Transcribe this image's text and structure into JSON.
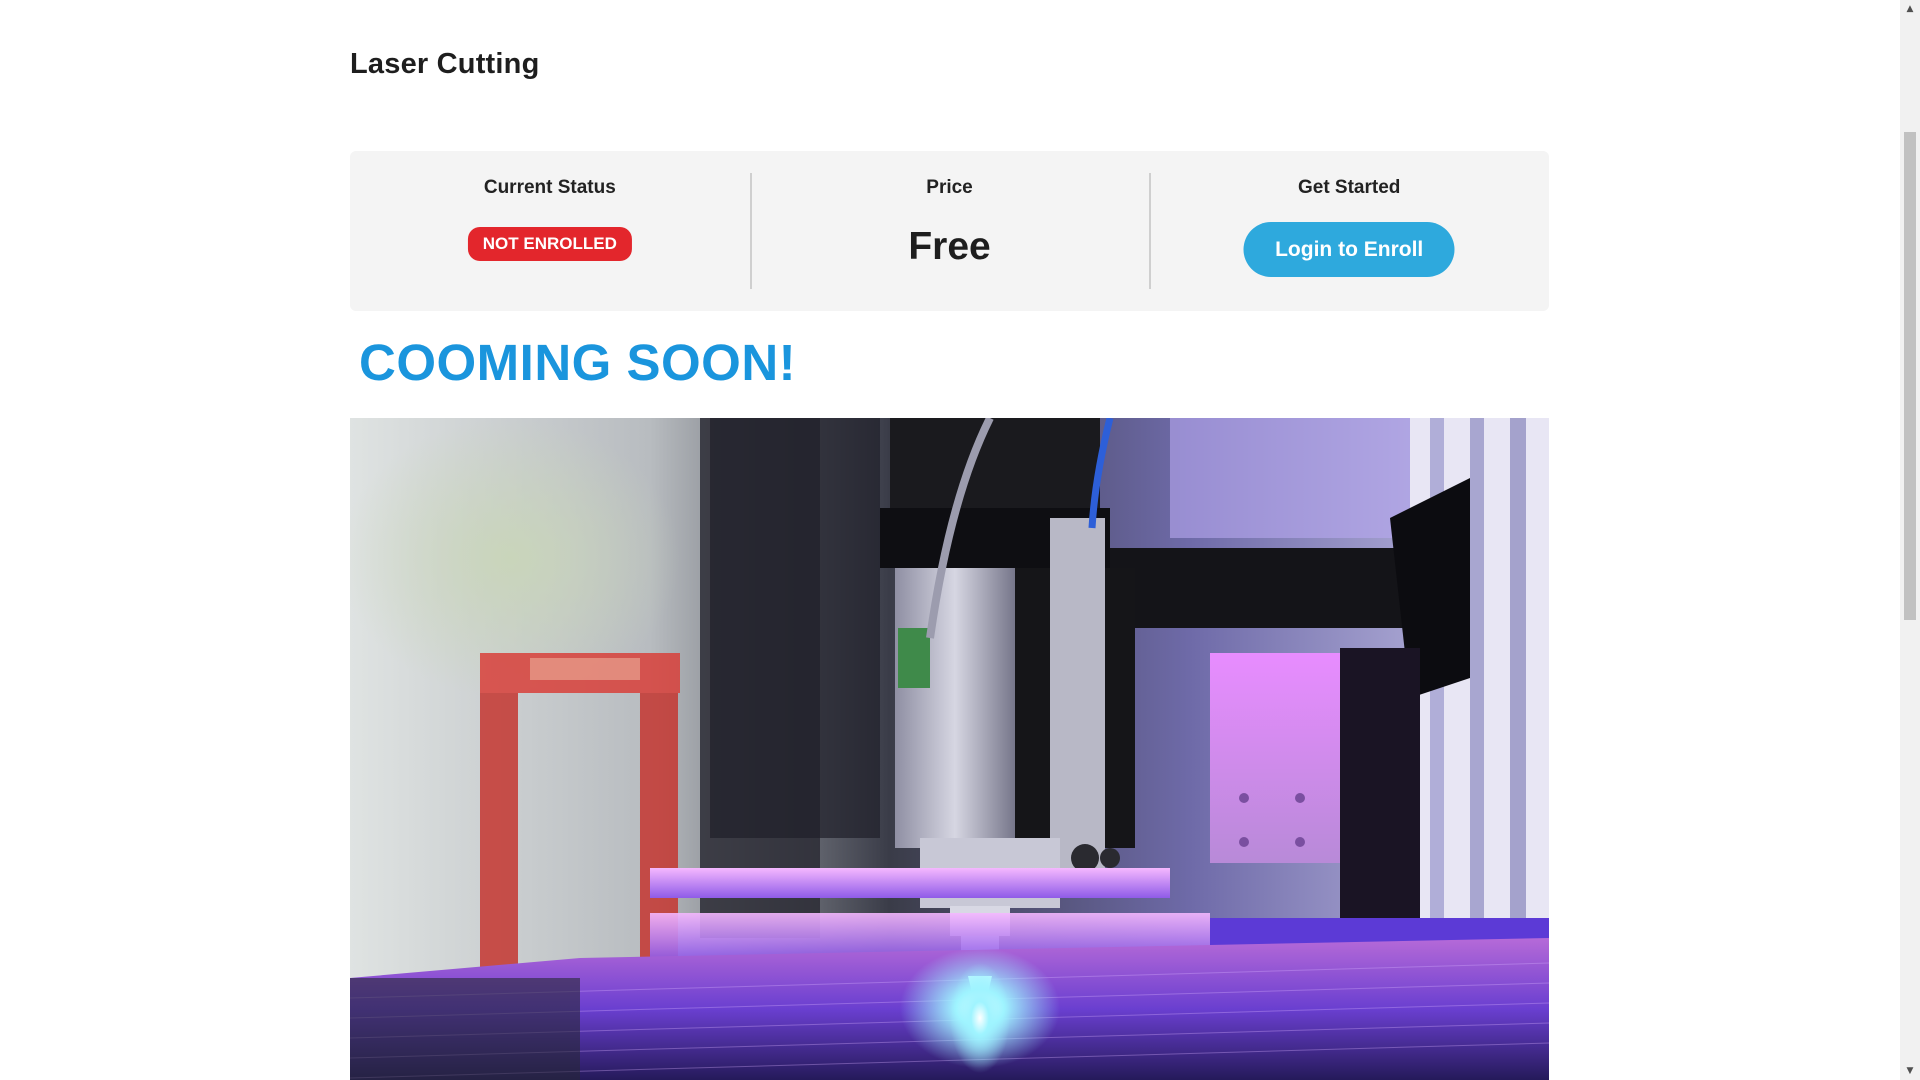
{
  "course": {
    "title": "Laser Cutting"
  },
  "info_panel": {
    "status": {
      "heading": "Current Status",
      "badge": "NOT ENROLLED"
    },
    "price": {
      "heading": "Price",
      "value": "Free"
    },
    "get_started": {
      "heading": "Get Started",
      "button_label": "Login to Enroll"
    }
  },
  "announcement": {
    "text": "COOMING SOON!"
  },
  "icons": {
    "scroll_up": "chevron-up-icon",
    "scroll_down": "chevron-down-icon"
  },
  "colors": {
    "accent": "#2ea9dd",
    "heading_blue": "#1a95dd",
    "badge_red": "#e3262c",
    "panel_bg": "#f4f4f4"
  }
}
